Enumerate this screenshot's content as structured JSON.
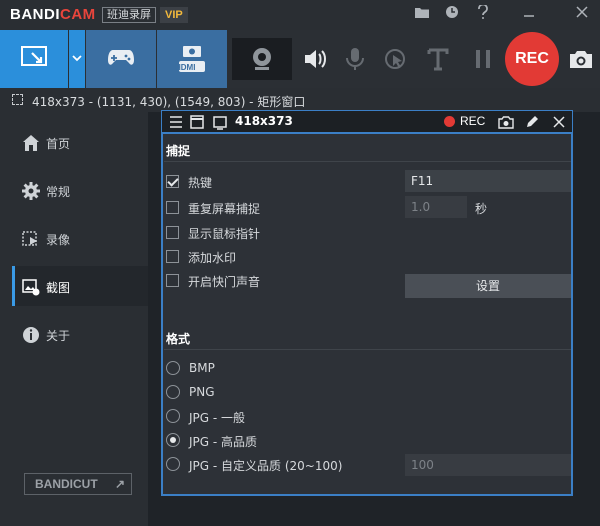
{
  "app": {
    "logo_main": "BANDI",
    "logo_accent": "CAM",
    "cn_badge": "班迪录屏",
    "vip_badge": "VIP"
  },
  "titlebar_icons": [
    "folder-icon",
    "clock-icon",
    "help-icon",
    "minimize-icon",
    "close-icon"
  ],
  "toolbar": {
    "modes": [
      "rectangle-mode",
      "game-mode",
      "hdmi-mode"
    ],
    "hdmi_label": "HDMI",
    "rec_label": "REC"
  },
  "status": {
    "text": "418x373 - (1131, 430), (1549, 803) - 矩形窗口"
  },
  "sidebar": {
    "items": [
      {
        "label": "首页",
        "icon": "home-icon"
      },
      {
        "label": "常规",
        "icon": "gear-icon"
      },
      {
        "label": "录像",
        "icon": "video-icon"
      },
      {
        "label": "截图",
        "icon": "image-icon"
      },
      {
        "label": "关于",
        "icon": "info-icon"
      }
    ],
    "active_index": 3,
    "bandicut_label": "BANDICUT",
    "bandicut_arrow": "↗"
  },
  "overlay": {
    "size": "418x373",
    "rec_label": "REC"
  },
  "capture": {
    "title": "捕捉",
    "hotkey_label": "热键",
    "hotkey_checked": true,
    "hotkey_value": "F11",
    "repeat_label": "重复屏幕捕捉",
    "repeat_checked": false,
    "repeat_value": "1.0",
    "repeat_unit": "秒",
    "cursor_label": "显示鼠标指针",
    "cursor_checked": false,
    "watermark_label": "添加水印",
    "watermark_checked": false,
    "shutter_label": "开启快门声音",
    "shutter_checked": false,
    "settings_label": "设置"
  },
  "format": {
    "title": "格式",
    "options": [
      {
        "label": "BMP",
        "checked": false
      },
      {
        "label": "PNG",
        "checked": false
      },
      {
        "label": "JPG - 一般",
        "checked": false
      },
      {
        "label": "JPG - 高品质",
        "checked": true
      },
      {
        "label": "JPG - 自定义品质 (20~100)",
        "checked": false
      }
    ],
    "custom_quality_value": "100"
  }
}
